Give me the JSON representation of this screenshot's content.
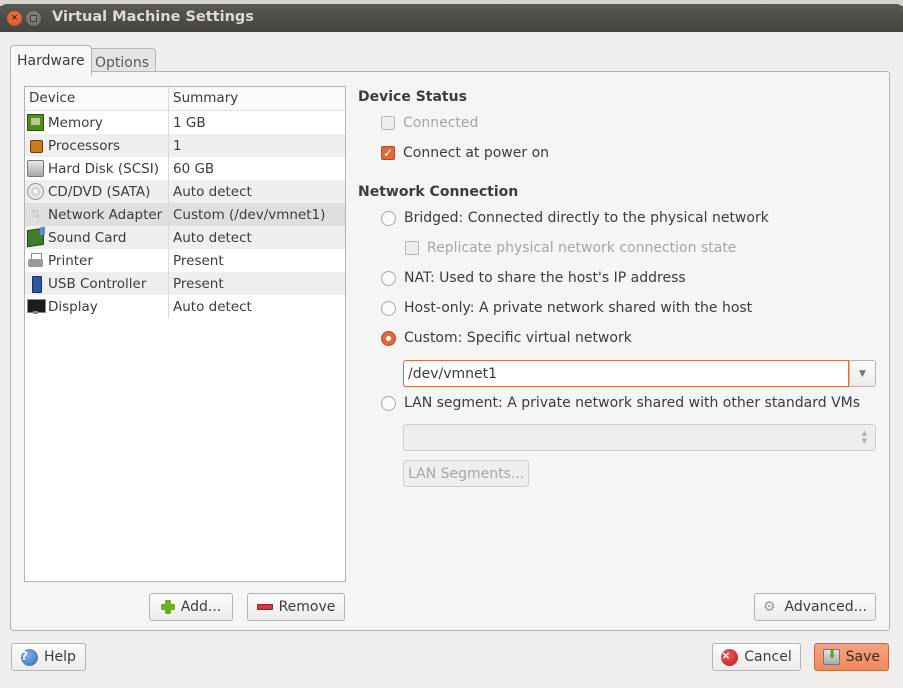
{
  "window": {
    "title": "Virtual Machine Settings",
    "close_icon": "close-icon",
    "maximize_icon": "maximize-icon"
  },
  "tabs": [
    {
      "label": "Hardware",
      "active": true
    },
    {
      "label": "Options",
      "active": false
    }
  ],
  "device_list": {
    "headers": {
      "device": "Device",
      "summary": "Summary"
    },
    "rows": [
      {
        "device": "Memory",
        "summary": "1 GB",
        "icon": "memory-icon"
      },
      {
        "device": "Processors",
        "summary": "1",
        "icon": "processor-icon"
      },
      {
        "device": "Hard Disk (SCSI)",
        "summary": "60 GB",
        "icon": "hard-disk-icon"
      },
      {
        "device": "CD/DVD (SATA)",
        "summary": "Auto detect",
        "icon": "cd-dvd-icon"
      },
      {
        "device": "Network Adapter",
        "summary": "Custom (/dev/vmnet1)",
        "icon": "network-adapter-icon",
        "selected": true
      },
      {
        "device": "Sound Card",
        "summary": "Auto detect",
        "icon": "sound-card-icon"
      },
      {
        "device": "Printer",
        "summary": "Present",
        "icon": "printer-icon"
      },
      {
        "device": "USB Controller",
        "summary": "Present",
        "icon": "usb-icon"
      },
      {
        "device": "Display",
        "summary": "Auto detect",
        "icon": "display-icon"
      }
    ],
    "add_label": "Add...",
    "remove_label": "Remove"
  },
  "device_status": {
    "heading": "Device Status",
    "connected": {
      "label": "Connected",
      "checked": false,
      "disabled": true
    },
    "connect_at_power_on": {
      "label": "Connect at power on",
      "checked": true
    }
  },
  "network_connection": {
    "heading": "Network Connection",
    "options": [
      {
        "label": "Bridged: Connected directly to the physical network",
        "selected": false
      },
      {
        "label": "NAT: Used to share the host's IP address",
        "selected": false
      },
      {
        "label": "Host-only: A private network shared with the host",
        "selected": false
      },
      {
        "label": "Custom: Specific virtual network",
        "selected": true
      },
      {
        "label": "LAN segment: A private network shared with other standard VMs",
        "selected": false
      }
    ],
    "replicate": {
      "label": "Replicate physical network connection state",
      "checked": false,
      "disabled": true
    },
    "custom_network_value": "/dev/vmnet1",
    "lan_segment_value": "",
    "lan_segments_button": "LAN Segments...",
    "advanced_button": "Advanced..."
  },
  "footer": {
    "help": "Help",
    "cancel": "Cancel",
    "save": "Save"
  },
  "colors": {
    "accent": "#e2693b",
    "titlebar": "#4f4e48",
    "save_button": "#f29670"
  }
}
